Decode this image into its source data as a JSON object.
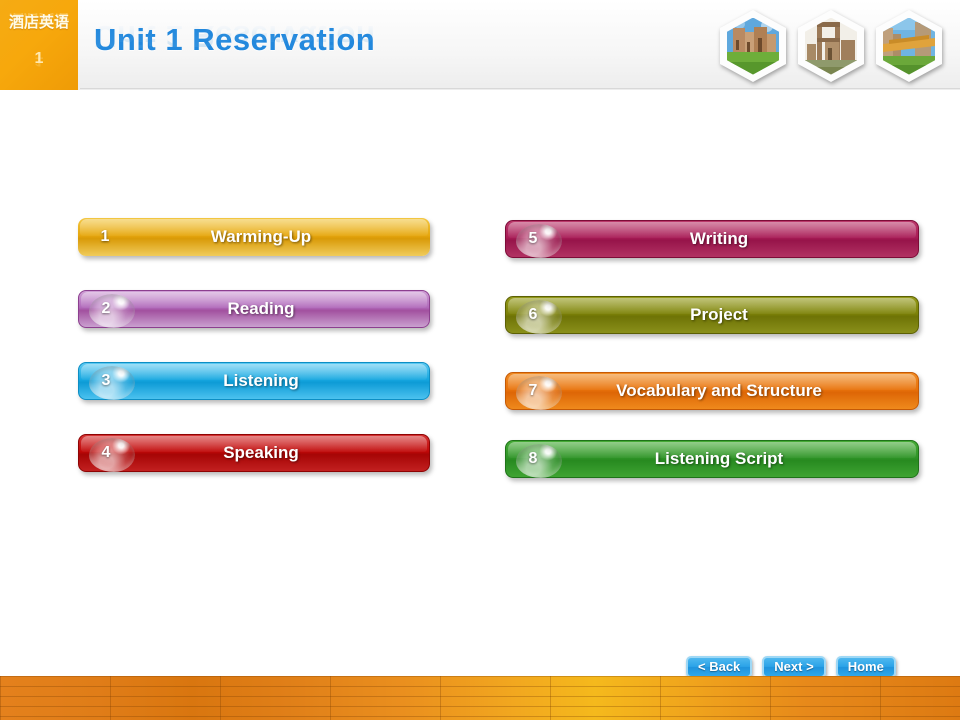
{
  "header": {
    "badge": {
      "course_name_cn": "酒店英语",
      "unit_number": "1"
    },
    "title": "Unit 1 Reservation",
    "thumbnails": [
      {
        "name": "hexagon-thumbnail-cathedral"
      },
      {
        "name": "hexagon-thumbnail-ruins"
      },
      {
        "name": "hexagon-thumbnail-bridge"
      }
    ]
  },
  "menu": {
    "left_column": [
      {
        "number": "1",
        "label": "Warming-Up",
        "color": "#e6a70e",
        "has_drop": false
      },
      {
        "number": "2",
        "label": "Reading",
        "color": "#a858b0",
        "has_drop": true
      },
      {
        "number": "3",
        "label": "Listening",
        "color": "#16a7e0",
        "has_drop": true
      },
      {
        "number": "4",
        "label": "Speaking",
        "color": "#c00808",
        "has_drop": true
      }
    ],
    "right_column": [
      {
        "number": "5",
        "label": "Writing",
        "color": "#a81b56",
        "has_drop": true
      },
      {
        "number": "6",
        "label": "Project",
        "color": "#7d8208",
        "has_drop": true
      },
      {
        "number": "7",
        "label": "Vocabulary and Structure",
        "color": "#e8720b",
        "has_drop": true
      },
      {
        "number": "8",
        "label": "Listening Script",
        "color": "#2f9427",
        "has_drop": true
      }
    ]
  },
  "nav": {
    "back_label": "< Back",
    "next_label": "Next >",
    "home_label": "Home"
  },
  "colors": {
    "title_blue": "#2288dd",
    "badge_orange": "#f7a80c",
    "nav_blue": "#2ba3e8",
    "footer_orange": "#e8901c",
    "background": "#ffffff"
  }
}
